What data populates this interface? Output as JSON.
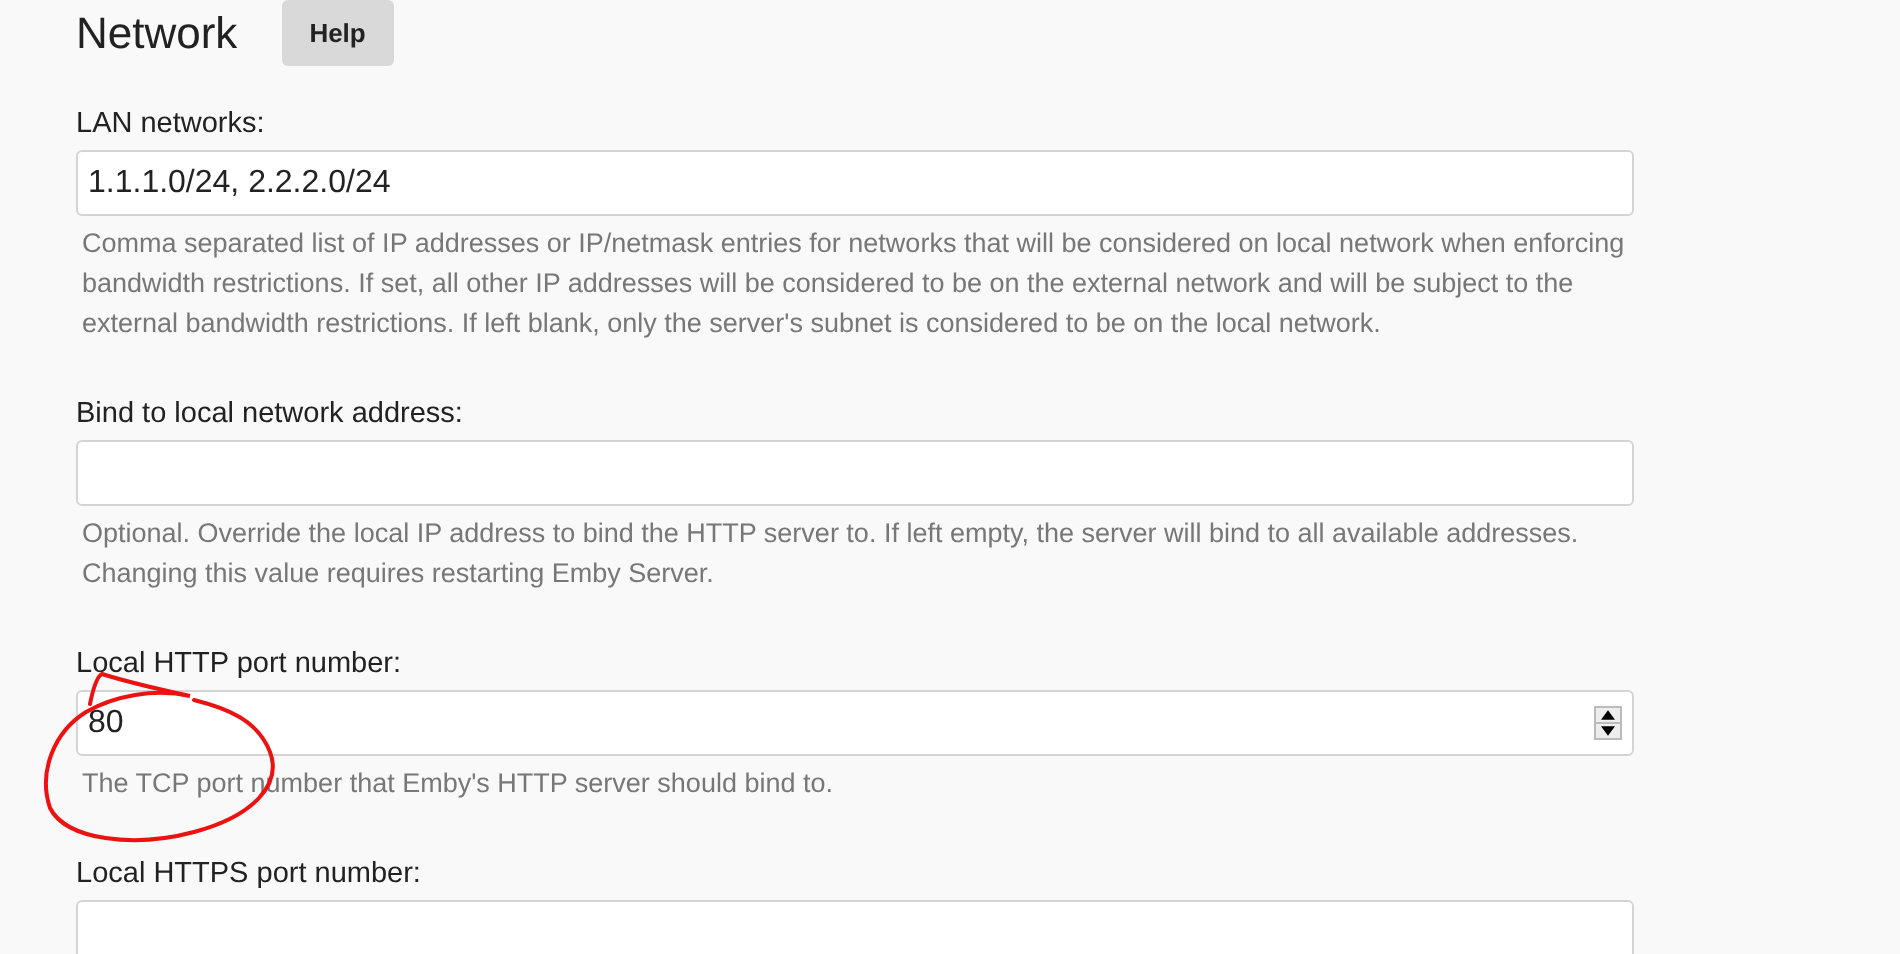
{
  "header": {
    "title": "Network",
    "help_button": "Help"
  },
  "fields": [
    {
      "kind": "text",
      "label": "LAN networks:",
      "value": "1.1.1.0/24, 2.2.2.0/24",
      "help": "Comma separated list of IP addresses or IP/netmask entries for networks that will be considered on local network when enforcing bandwidth restrictions. If set, all other IP addresses will be considered to be on the external network and will be subject to the external bandwidth restrictions. If left blank, only the server's subnet is considered to be on the local network."
    },
    {
      "kind": "text",
      "label": "Bind to local network address:",
      "help": "Optional. Override the local IP address to bind the HTTP server to. If left empty, the server will bind to all available addresses. Changing this value requires restarting Emby Server."
    },
    {
      "kind": "number",
      "label": "Local HTTP port number:",
      "value": "80",
      "help": "The TCP port number that Emby's HTTP server should bind to."
    },
    {
      "kind": "text",
      "label": "Local HTTPS port number:"
    }
  ]
}
